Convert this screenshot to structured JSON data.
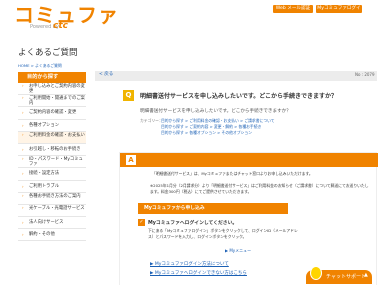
{
  "header": {
    "logo": "コミュファ",
    "logo_sub": "Powered by",
    "logo_brand": "ctc",
    "btn1": "Web メール認証",
    "btn2": "Myコミュファログイン"
  },
  "page": {
    "title": "よくあるご質問",
    "breadcrumb": "HOME > よくあるご質問"
  },
  "sidebar": {
    "heading": "目的から探す",
    "items": [
      {
        "label": "お申し込みとご契約内容の変更",
        "two": true
      },
      {
        "label": "ご利用開始・開通までのご案内",
        "two": true
      },
      {
        "label": "ご契約内容の確認・変更",
        "two": false
      },
      {
        "label": "各種オプション",
        "two": false
      },
      {
        "label": "ご利用料金の確認・お支払い",
        "two": true
      },
      {
        "label": "お引越し・移転のお手続き",
        "two": false
      },
      {
        "label": "ID・パスワード・Myコミュファ",
        "two": true
      },
      {
        "label": "接続・設定方法",
        "two": false
      },
      {
        "label": "ご利用トラブル",
        "two": false
      },
      {
        "label": "各種お手続き方法のご案内",
        "two": true
      },
      {
        "label": "光ケーブル・光電話サービス",
        "two": true
      },
      {
        "label": "法人向けサービス",
        "two": false
      },
      {
        "label": "解約・その他",
        "two": false
      }
    ]
  },
  "main": {
    "back": "< 戻る",
    "qnum": "No : 2079",
    "question_badge": "Q",
    "question_title": "明細書送付サービスを申し込みしたいです。どこから手続きできますか？",
    "question_summary": "明細書送付サービスを申し込みしたいです。どこから手続きできますか？",
    "category_label": "カテゴリー：",
    "categories": [
      "目的から探す > ご利用料金の確認・お支払い > ご請求書について",
      "目的から探す > ご契約内容 > 変更・解約 > 各種お手続き",
      "目的から探す > 各種オプション > その他オプション"
    ],
    "answer_badge": "A",
    "answer_p1": "「明細書送付サービス」は、Myコミュファまたはチャット窓口よりお申し込みいただけます。",
    "answer_p2": "※2025年1月分（2月請求分）より「明細書送付サービス」はご利用料金のお知らせ（ご請求書）について郵送にてお送りいたします。料金300円（税込）にてご提供させていただきます。",
    "section_head": "Myコミュファから申し込み",
    "step_title": "Myコミュファへログインしてください。",
    "step_body": "下にある「Myコミュファログイン」ボタンをクリックして、ログインID（メールアドレス）とパスワードを入力し、ログインボタンをクリック。",
    "logout_label": "▶ Myメニュー",
    "link1": "▶ Myコミュファログイン方法について",
    "link2": "▶ Myコミュファへログインできない方はこちら"
  },
  "chat": {
    "label": "チャットサポート",
    "arrow": "▲"
  }
}
